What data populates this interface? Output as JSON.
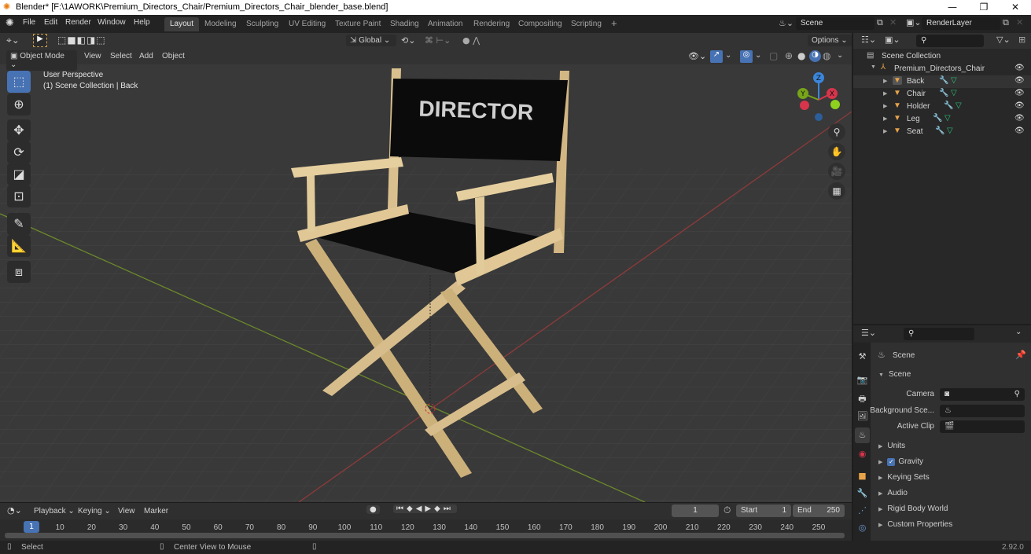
{
  "window": {
    "title": "Blender* [F:\\1AWORK\\Premium_Directors_Chair/Premium_Directors_Chair_blender_base.blend]",
    "controls": {
      "minimize": "—",
      "maximize": "❐",
      "close": "✕"
    }
  },
  "menubar": {
    "items": [
      "File",
      "Edit",
      "Render",
      "Window",
      "Help"
    ],
    "workspaces": [
      "Layout",
      "Modeling",
      "Sculpting",
      "UV Editing",
      "Texture Paint",
      "Shading",
      "Animation",
      "Rendering",
      "Compositing",
      "Scripting"
    ],
    "active_workspace": "Layout",
    "add_workspace": "+",
    "scene_field": "Scene",
    "view_layer_field": "RenderLayer"
  },
  "viewport": {
    "header": {
      "transform_orientation": "Global",
      "options_label": "Options",
      "mode": "Object Mode",
      "menus": [
        "View",
        "Select",
        "Add",
        "Object"
      ]
    },
    "overlay_text": {
      "view_name": "User Perspective",
      "collection_info": "(1) Scene Collection | Back"
    },
    "gizmo": {
      "z": "Z",
      "y": "Y",
      "x": "X",
      "colors": {
        "x": "#d6354b",
        "y": "#77a41a",
        "z": "#3b86db"
      }
    },
    "model_text": "DIRECTOR"
  },
  "outliner": {
    "root": "Scene Collection",
    "collection": "Premium_Directors_Chair",
    "objects": [
      "Back",
      "Chair",
      "Holder",
      "Leg",
      "Seat"
    ]
  },
  "properties": {
    "context_title": "Scene",
    "panel_title": "Scene",
    "fields": [
      {
        "label": "Camera",
        "value": ""
      },
      {
        "label": "Background Sce...",
        "value": ""
      },
      {
        "label": "Active Clip",
        "value": ""
      }
    ],
    "sections": [
      {
        "label": "Units",
        "checkbox": false
      },
      {
        "label": "Gravity",
        "checkbox": true,
        "checked": true
      },
      {
        "label": "Keying Sets",
        "checkbox": false
      },
      {
        "label": "Audio",
        "checkbox": false
      },
      {
        "label": "Rigid Body World",
        "checkbox": false
      },
      {
        "label": "Custom Properties",
        "checkbox": false
      }
    ]
  },
  "timeline": {
    "menus": [
      "Playback",
      "Keying",
      "View",
      "Marker"
    ],
    "current_frame": "1",
    "start_label": "Start",
    "start": "1",
    "end_label": "End",
    "end": "250",
    "ticks": [
      "10",
      "20",
      "30",
      "40",
      "50",
      "60",
      "70",
      "80",
      "90",
      "100",
      "110",
      "120",
      "130",
      "140",
      "150",
      "160",
      "170",
      "180",
      "190",
      "200",
      "210",
      "220",
      "230",
      "240",
      "250"
    ],
    "playhead": "1"
  },
  "statusbar": {
    "left": "Select",
    "middle": "Center View to Mouse",
    "version": "2.92.0"
  },
  "colors": {
    "accent": "#4772b3",
    "object_orange": "#e8a34a",
    "modifier_blue": "#6d9bd6",
    "mesh_green": "#2ec27e"
  }
}
